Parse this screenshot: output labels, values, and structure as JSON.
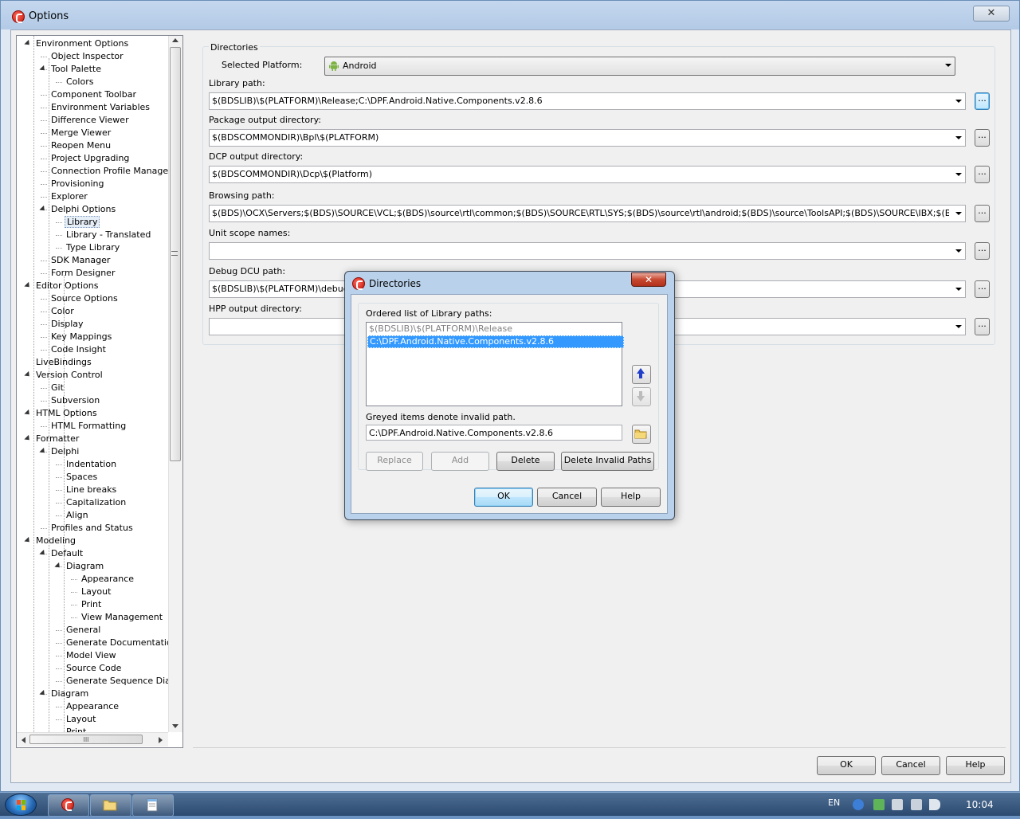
{
  "window": {
    "title": "Options",
    "close_glyph": "✕"
  },
  "tree": {
    "items": [
      {
        "label": "Environment Options",
        "level": 0,
        "expanded": true
      },
      {
        "label": "Object Inspector",
        "level": 1
      },
      {
        "label": "Tool Palette",
        "level": 1,
        "expanded": true
      },
      {
        "label": "Colors",
        "level": 2
      },
      {
        "label": "Component Toolbar",
        "level": 1
      },
      {
        "label": "Environment Variables",
        "level": 1
      },
      {
        "label": "Difference Viewer",
        "level": 1
      },
      {
        "label": "Merge Viewer",
        "level": 1
      },
      {
        "label": "Reopen Menu",
        "level": 1
      },
      {
        "label": "Project Upgrading",
        "level": 1
      },
      {
        "label": "Connection Profile Manager",
        "level": 1
      },
      {
        "label": "Provisioning",
        "level": 1
      },
      {
        "label": "Explorer",
        "level": 1
      },
      {
        "label": "Delphi Options",
        "level": 1,
        "expanded": true
      },
      {
        "label": "Library",
        "level": 2,
        "selected": true
      },
      {
        "label": "Library - Translated",
        "level": 2
      },
      {
        "label": "Type Library",
        "level": 2
      },
      {
        "label": "SDK Manager",
        "level": 1
      },
      {
        "label": "Form Designer",
        "level": 1
      },
      {
        "label": "Editor Options",
        "level": 0,
        "expanded": true
      },
      {
        "label": "Source Options",
        "level": 1
      },
      {
        "label": "Color",
        "level": 1
      },
      {
        "label": "Display",
        "level": 1
      },
      {
        "label": "Key Mappings",
        "level": 1
      },
      {
        "label": "Code Insight",
        "level": 1
      },
      {
        "label": "LiveBindings",
        "level": 0
      },
      {
        "label": "Version Control",
        "level": 0,
        "expanded": true
      },
      {
        "label": "Git",
        "level": 1
      },
      {
        "label": "Subversion",
        "level": 1
      },
      {
        "label": "HTML Options",
        "level": 0,
        "expanded": true
      },
      {
        "label": "HTML Formatting",
        "level": 1
      },
      {
        "label": "Formatter",
        "level": 0,
        "expanded": true
      },
      {
        "label": "Delphi",
        "level": 1,
        "expanded": true
      },
      {
        "label": "Indentation",
        "level": 2
      },
      {
        "label": "Spaces",
        "level": 2
      },
      {
        "label": "Line breaks",
        "level": 2
      },
      {
        "label": "Capitalization",
        "level": 2
      },
      {
        "label": "Align",
        "level": 2
      },
      {
        "label": "Profiles and Status",
        "level": 1
      },
      {
        "label": "Modeling",
        "level": 0,
        "expanded": true
      },
      {
        "label": "Default",
        "level": 1,
        "expanded": true
      },
      {
        "label": "Diagram",
        "level": 2,
        "expanded": true
      },
      {
        "label": "Appearance",
        "level": 3
      },
      {
        "label": "Layout",
        "level": 3
      },
      {
        "label": "Print",
        "level": 3
      },
      {
        "label": "View Management",
        "level": 3
      },
      {
        "label": "General",
        "level": 2
      },
      {
        "label": "Generate Documentation",
        "level": 2
      },
      {
        "label": "Model View",
        "level": 2
      },
      {
        "label": "Source Code",
        "level": 2
      },
      {
        "label": "Generate Sequence Diagra",
        "level": 2
      },
      {
        "label": "Diagram",
        "level": 1,
        "expanded": true
      },
      {
        "label": "Appearance",
        "level": 2
      },
      {
        "label": "Layout",
        "level": 2
      },
      {
        "label": "Print",
        "level": 2
      }
    ],
    "hscroll_grip": "III"
  },
  "directories": {
    "group_label": "Directories",
    "platform_label": "Selected Platform:",
    "platform_value": "Android",
    "fields": [
      {
        "label": "Library path:",
        "value": "$(BDSLIB)\\$(PLATFORM)\\Release;C:\\DPF.Android.Native.Components.v2.8.6"
      },
      {
        "label": "Package output directory:",
        "value": "$(BDSCOMMONDIR)\\Bpl\\$(PLATFORM)"
      },
      {
        "label": "DCP output directory:",
        "value": "$(BDSCOMMONDIR)\\Dcp\\$(Platform)"
      },
      {
        "label": "Browsing path:",
        "value": "$(BDS)\\OCX\\Servers;$(BDS)\\SOURCE\\VCL;$(BDS)\\source\\rtl\\common;$(BDS)\\SOURCE\\RTL\\SYS;$(BDS)\\source\\rtl\\android;$(BDS)\\source\\ToolsAPI;$(BDS)\\SOURCE\\IBX;$(BDS)\\source\\Internet"
      },
      {
        "label": "Unit scope names:",
        "value": ""
      },
      {
        "label": "Debug DCU path:",
        "value": "$(BDSLIB)\\$(PLATFORM)\\debug"
      },
      {
        "label": "HPP output directory:",
        "value": ""
      }
    ],
    "browse_glyph": "..."
  },
  "footer": {
    "ok": "OK",
    "cancel": "Cancel",
    "help": "Help"
  },
  "dialog": {
    "title": "Directories",
    "close_glyph": "✕",
    "list_label": "Ordered list of Library paths:",
    "list_items": [
      {
        "text": "$(BDSLIB)\\$(PLATFORM)\\Release",
        "state": "invalid"
      },
      {
        "text": "C:\\DPF.Android.Native.Components.v2.8.6",
        "state": "selected"
      }
    ],
    "note": "Greyed items denote invalid path.",
    "edit_value": "C:\\DPF.Android.Native.Components.v2.8.6",
    "buttons": {
      "replace": "Replace",
      "add": "Add",
      "delete": "Delete",
      "delete_invalid": "Delete Invalid Paths",
      "ok": "OK",
      "cancel": "Cancel",
      "help": "Help"
    }
  },
  "taskbar": {
    "language": "EN",
    "clock": "10:04"
  },
  "colors": {
    "selection": "#3399ff",
    "window_frame": "#dfe8f3",
    "taskbar": "#2c4a70"
  }
}
